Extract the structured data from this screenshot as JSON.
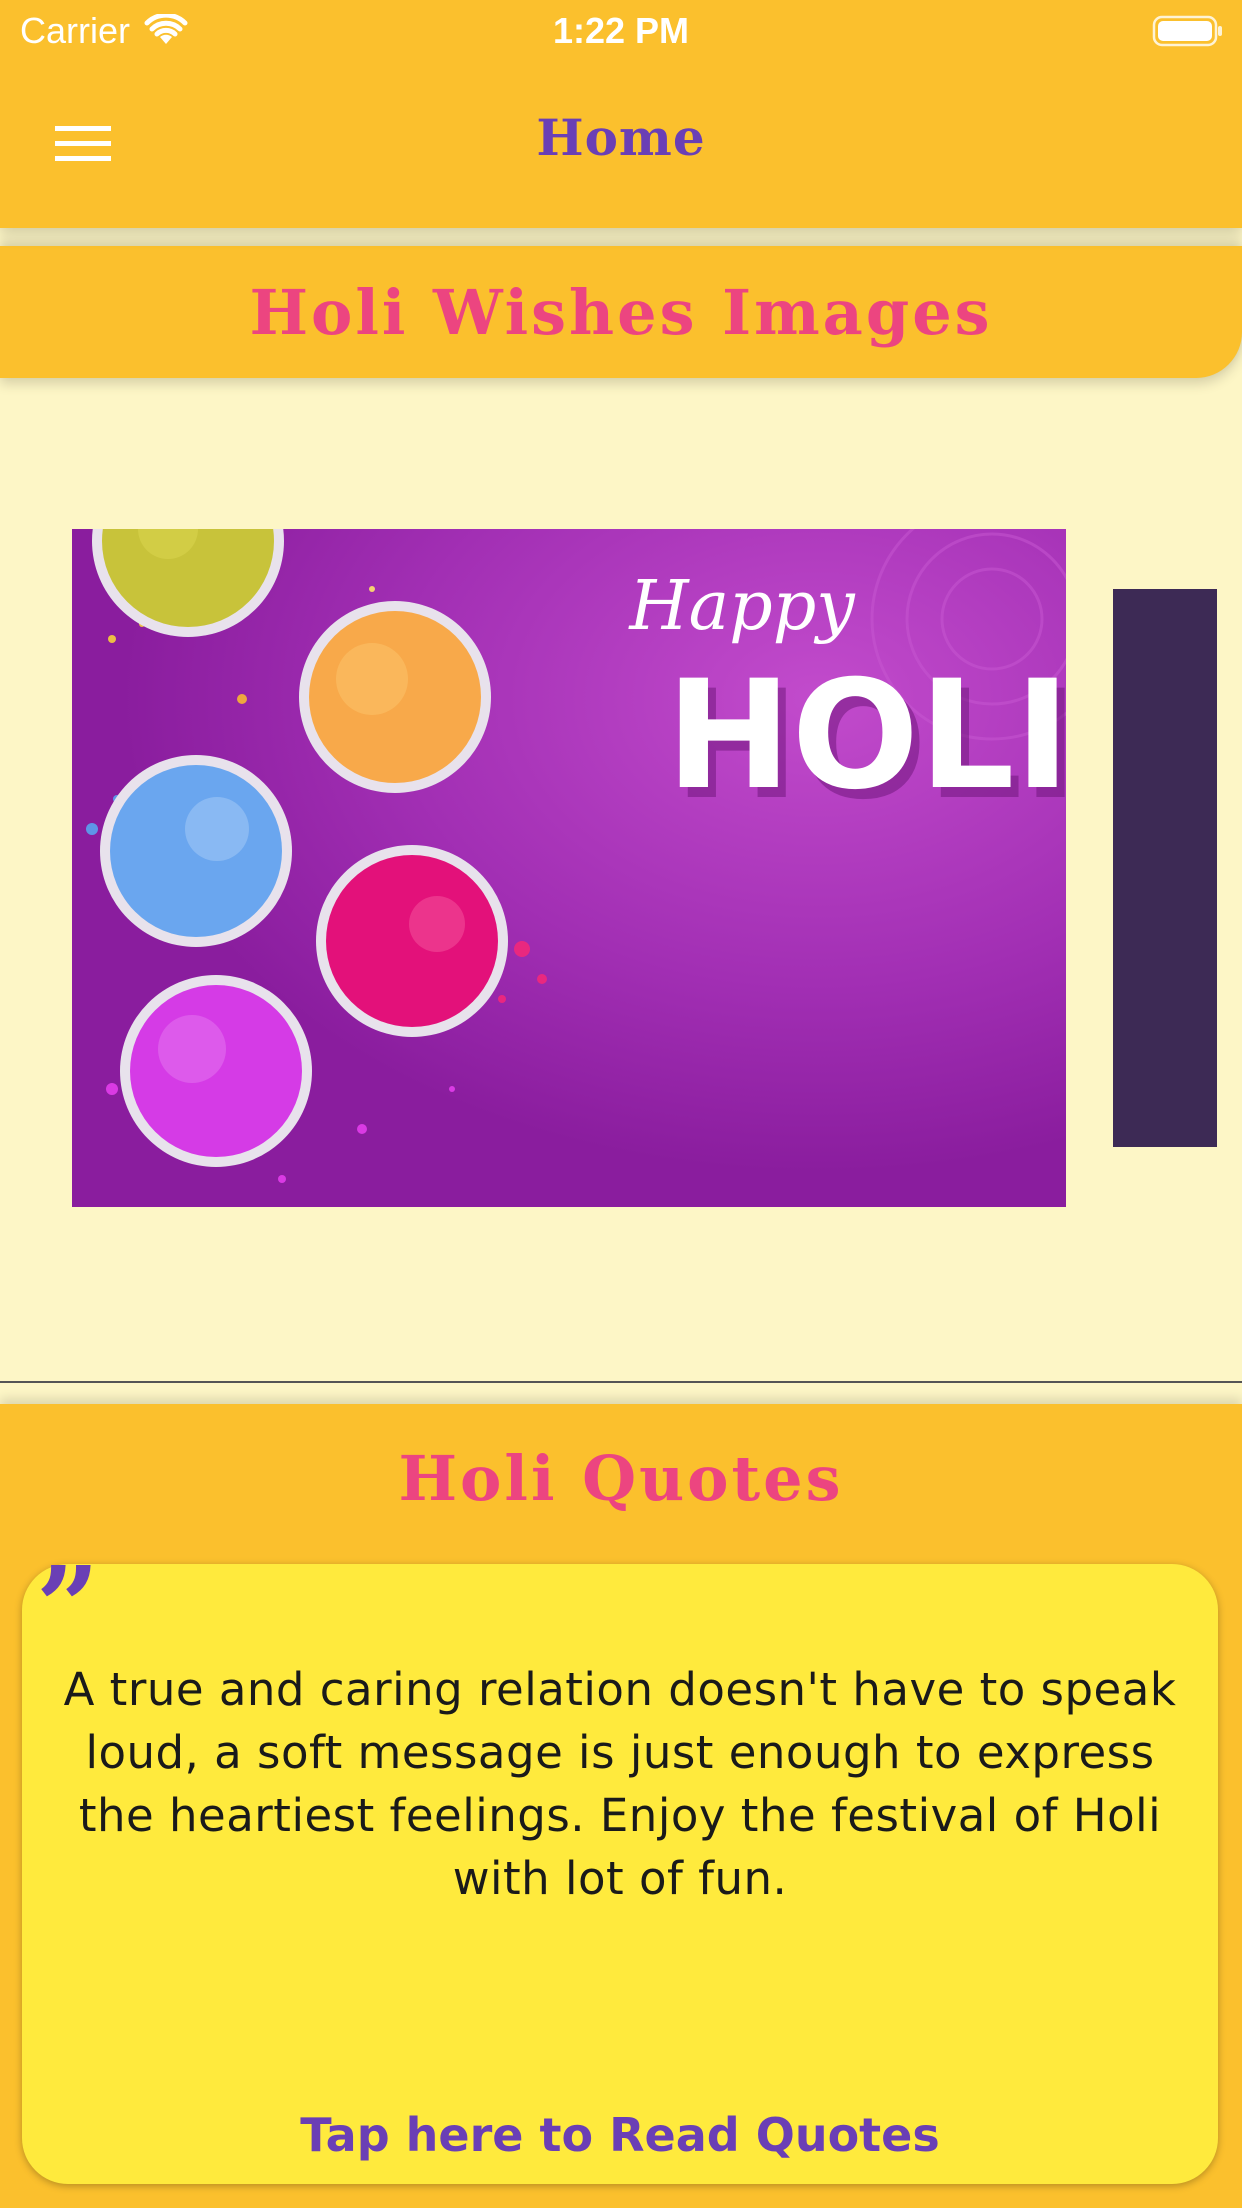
{
  "status_bar": {
    "carrier": "Carrier",
    "time": "1:22 PM"
  },
  "nav": {
    "title": "Home"
  },
  "wishes": {
    "title": "Holi Wishes Images",
    "card": {
      "happy": "Happy",
      "holi": "HOLI"
    }
  },
  "quotes": {
    "title": "Holi Quotes",
    "quote_text": "A true and caring relation doesn't have to speak loud, a soft message is just enough to express the heartiest feelings. Enjoy the festival of Holi with lot of fun.",
    "link_label": "Tap here to Read Quotes"
  },
  "colors": {
    "bar_yellow": "#FBC02D",
    "page_cream": "#FDF6C6",
    "title_pink": "#EC4580",
    "nav_purple": "#6A3FB5",
    "quote_card_yellow": "#FFEA3D",
    "next_card_dark": "#3D2A55"
  },
  "icons": {
    "wifi": "wifi-icon",
    "battery": "battery-icon",
    "menu": "hamburger-menu-icon",
    "quote": "quote-mark-icon"
  }
}
